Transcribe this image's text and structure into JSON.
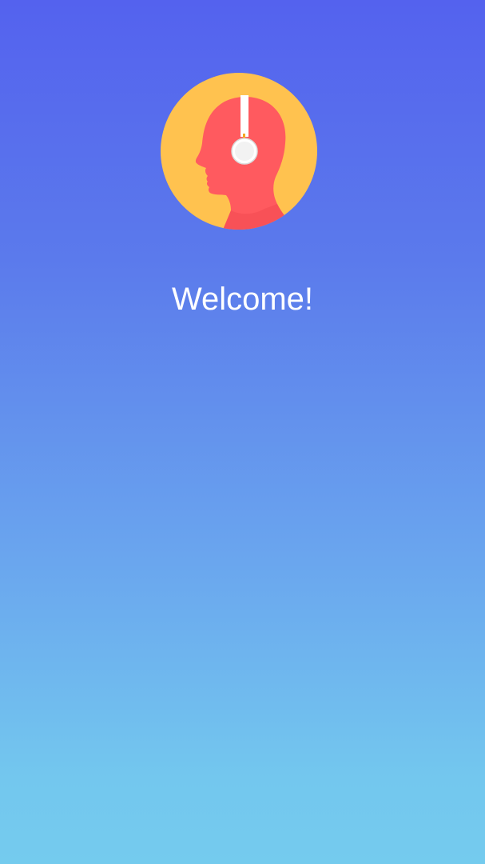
{
  "welcome": {
    "heading": "Welcome!"
  },
  "logo": {
    "icon": "head-with-headphones-icon",
    "colors": {
      "circle": "#FFC24F",
      "head": "#FF5A5F",
      "headphone": "#FFFFFF"
    }
  },
  "theme": {
    "gradient_top": "#5462EE",
    "gradient_bottom": "#74CBEE",
    "text_color": "#FFFFFF"
  }
}
